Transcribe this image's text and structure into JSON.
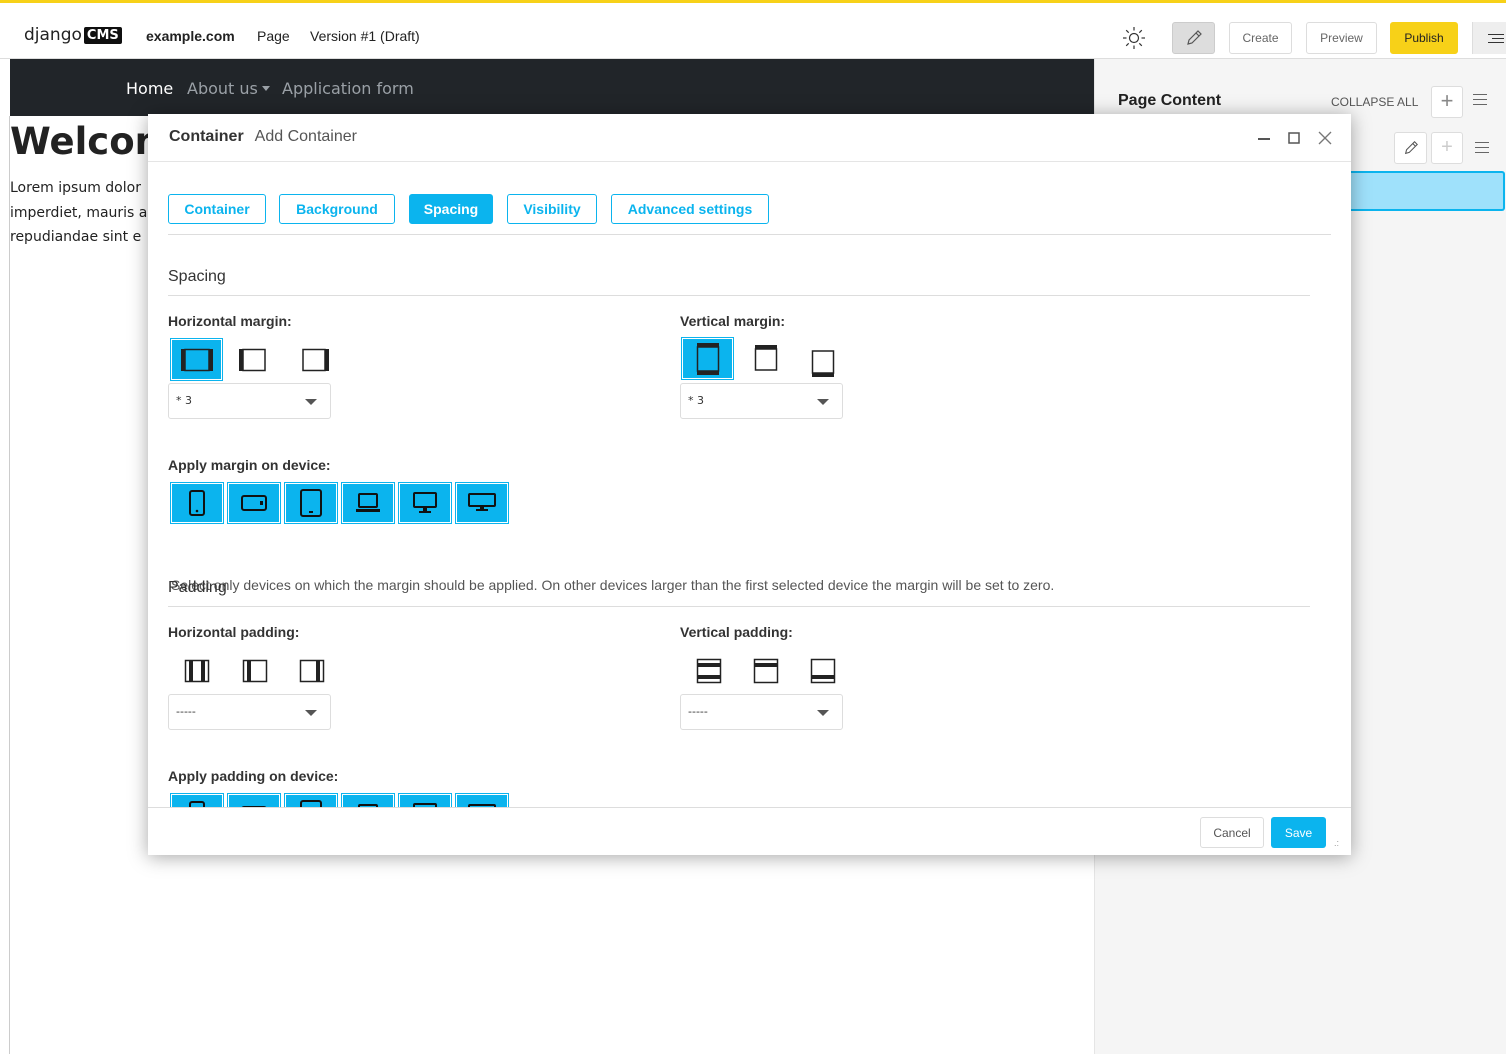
{
  "colors": {
    "accent": "#0bb4ee",
    "publish": "#f7d118",
    "navbar": "#212529"
  },
  "toolbar": {
    "logo_text": "django",
    "logo_badge": "CMS",
    "site": "example.com",
    "page_menu": "Page",
    "version": "Version #1 (Draft)",
    "theme_icon": "sun-icon",
    "edit_icon": "pencil-icon",
    "create_label": "Create",
    "preview_label": "Preview",
    "publish_label": "Publish"
  },
  "site": {
    "nav": {
      "home": "Home",
      "about": "About us",
      "application": "Application form"
    },
    "heading": "Welcom",
    "lorem_lines": [
      "Lorem ipsum dolor",
      "imperdiet, mauris a",
      "repudiandae sint e"
    ]
  },
  "sidebar": {
    "title": "Page Content",
    "collapse_all": "COLLAPSE ALL",
    "add_label": "+"
  },
  "modal": {
    "breadcrumb": [
      "Container",
      "Add Container"
    ],
    "tabs": [
      {
        "label": "Container",
        "active": false
      },
      {
        "label": "Background",
        "active": false
      },
      {
        "label": "Spacing",
        "active": true
      },
      {
        "label": "Visibility",
        "active": false
      },
      {
        "label": "Advanced settings",
        "active": false
      }
    ],
    "spacing": {
      "title": "Spacing",
      "horizontal_margin": {
        "label": "Horizontal margin:",
        "value": "* 3",
        "selected": "both"
      },
      "vertical_margin": {
        "label": "Vertical margin:",
        "value": "* 3",
        "selected": "both"
      },
      "device_label": "Apply margin on device:",
      "devices": [
        "phone-icon",
        "tablet-landscape-icon",
        "tablet-icon",
        "laptop-icon",
        "desktop-icon",
        "wide-desktop-icon"
      ],
      "help": "Select only devices on which the margin should be applied. On other devices larger than the first selected device the margin will be set to zero."
    },
    "padding": {
      "title": "Padding",
      "horizontal_padding": {
        "label": "Horizontal padding:",
        "value": "-----"
      },
      "vertical_padding": {
        "label": "Vertical padding:",
        "value": "-----"
      },
      "device_label": "Apply padding on device:"
    },
    "footer": {
      "cancel_label": "Cancel",
      "save_label": "Save"
    }
  }
}
